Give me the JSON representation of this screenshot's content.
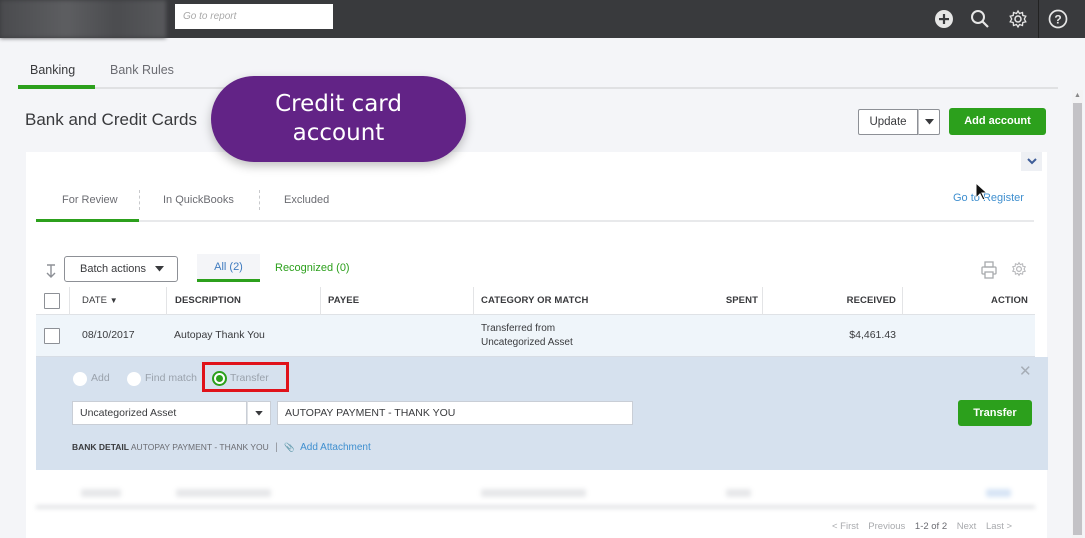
{
  "topbar": {
    "report_search_placeholder": "Go to report",
    "icons": [
      "plus-circle-icon",
      "search-icon",
      "gear-icon",
      "help-icon"
    ]
  },
  "main_tabs": [
    {
      "label": "Banking",
      "active": true
    },
    {
      "label": "Bank Rules",
      "active": false
    }
  ],
  "page_title": "Bank and Credit Cards",
  "callout": {
    "line1": "Credit card",
    "line2": "account",
    "color": "#622386"
  },
  "header_buttons": {
    "update": "Update",
    "add_account": "Add account"
  },
  "sub_tabs": [
    {
      "label": "For Review",
      "active": true
    },
    {
      "label": "In QuickBooks",
      "active": false
    },
    {
      "label": "Excluded",
      "active": false
    }
  ],
  "go_to_register": "Go to Register",
  "toolbar": {
    "batch_actions": "Batch actions",
    "filter_all": "All (2)",
    "filter_recognized": "Recognized (0)"
  },
  "table": {
    "columns": [
      "DATE",
      "DESCRIPTION",
      "PAYEE",
      "CATEGORY OR MATCH",
      "SPENT",
      "RECEIVED",
      "ACTION"
    ],
    "rows": [
      {
        "date": "08/10/2017",
        "description": "Autopay Thank You",
        "payee": "",
        "category_line1": "Transferred from",
        "category_line2": "Uncategorized Asset",
        "spent": "",
        "received": "$4,461.43",
        "action": ""
      }
    ]
  },
  "detail_panel": {
    "radio_options": [
      {
        "label": "Add",
        "selected": false
      },
      {
        "label": "Find match",
        "selected": false
      },
      {
        "label": "Transfer",
        "selected": true
      }
    ],
    "category_value": "Uncategorized Asset",
    "memo_value": "AUTOPAY PAYMENT - THANK YOU",
    "transfer_button": "Transfer",
    "bank_detail_label": "BANK DETAIL",
    "bank_detail_value": "AUTOPAY PAYMENT - THANK YOU",
    "separator": "|",
    "add_attachment": "Add Attachment"
  },
  "pager": {
    "first": "< First",
    "previous": "Previous",
    "range": "1-2 of 2",
    "next": "Next",
    "last": "Last >"
  },
  "colors": {
    "accent_green": "#2ca01c",
    "link_blue": "#3f8fcf",
    "highlight_red": "#e0121a",
    "topbar": "#393a3d",
    "panel_bg": "#d6e1ee"
  }
}
